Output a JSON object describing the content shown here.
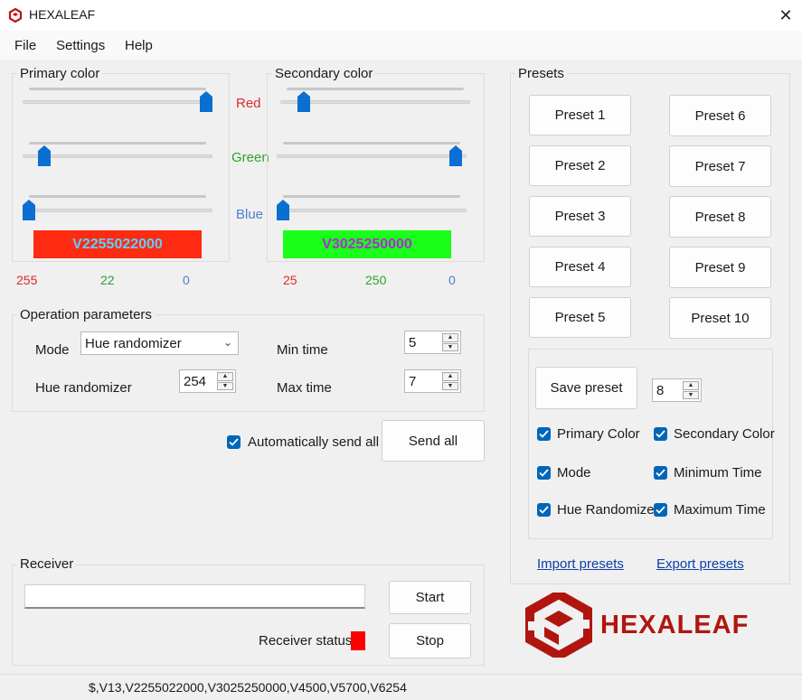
{
  "window": {
    "title": "HEXALEAF",
    "close_glyph": "✕"
  },
  "menu": {
    "items": [
      "File",
      "Settings",
      "Help"
    ]
  },
  "primary": {
    "title": "Primary color",
    "swatch_text": "V2255022000",
    "swatch_color": "#ff2a12",
    "swatch_text_color": "#5ad1ff",
    "values": {
      "red": "255",
      "green": "22",
      "blue": "0"
    },
    "levels": {
      "red": 1.0,
      "green": 0.086,
      "blue": 0.0
    }
  },
  "secondary": {
    "title": "Secondary color",
    "swatch_text": "V3025250000",
    "swatch_color": "#19ff19",
    "swatch_text_color": "#b12bd6",
    "values": {
      "red": "25",
      "green": "250",
      "blue": "0"
    },
    "levels": {
      "red": 0.098,
      "green": 0.98,
      "blue": 0.0
    }
  },
  "labels": {
    "red": "Red",
    "green": "Green",
    "blue": "Blue"
  },
  "label_colors": {
    "red": "#e0282b",
    "green": "#2ea02e",
    "blue": "#4a7fd0"
  },
  "operation": {
    "title": "Operation parameters",
    "mode_label": "Mode",
    "mode_value": "Hue randomizer",
    "hue_label": "Hue randomizer",
    "hue_value": "254",
    "min_time_label": "Min time",
    "min_time_value": "5",
    "max_time_label": "Max time",
    "max_time_value": "7"
  },
  "auto_send": {
    "label": "Automatically send all",
    "checked": true
  },
  "send_all_label": "Send all",
  "receiver": {
    "title": "Receiver",
    "input_value": "",
    "start_label": "Start",
    "stop_label": "Stop",
    "status_label": "Receiver status",
    "status_color": "#ff0000"
  },
  "presets": {
    "title": "Presets",
    "left": [
      "Preset 1",
      "Preset 2",
      "Preset 3",
      "Preset 4",
      "Preset 5"
    ],
    "right": [
      "Preset 6",
      "Preset 7",
      "Preset 8",
      "Preset 9",
      "Preset 10"
    ],
    "save_label": "Save preset",
    "save_slot": "8",
    "checks": {
      "primary": "Primary Color",
      "secondary": "Secondary Color",
      "mode": "Mode",
      "min_time": "Minimum Time",
      "hue": "Hue Randomize",
      "max_time": "Maximum Time"
    },
    "import_label": "Import presets",
    "export_label": "Export presets"
  },
  "logo": {
    "text": "HEXALEAF",
    "color": "#b0160f"
  },
  "status_bar": {
    "text": "$,V13,V2255022000,V3025250000,V4500,V5700,V6254"
  },
  "accent": "#0066b8"
}
